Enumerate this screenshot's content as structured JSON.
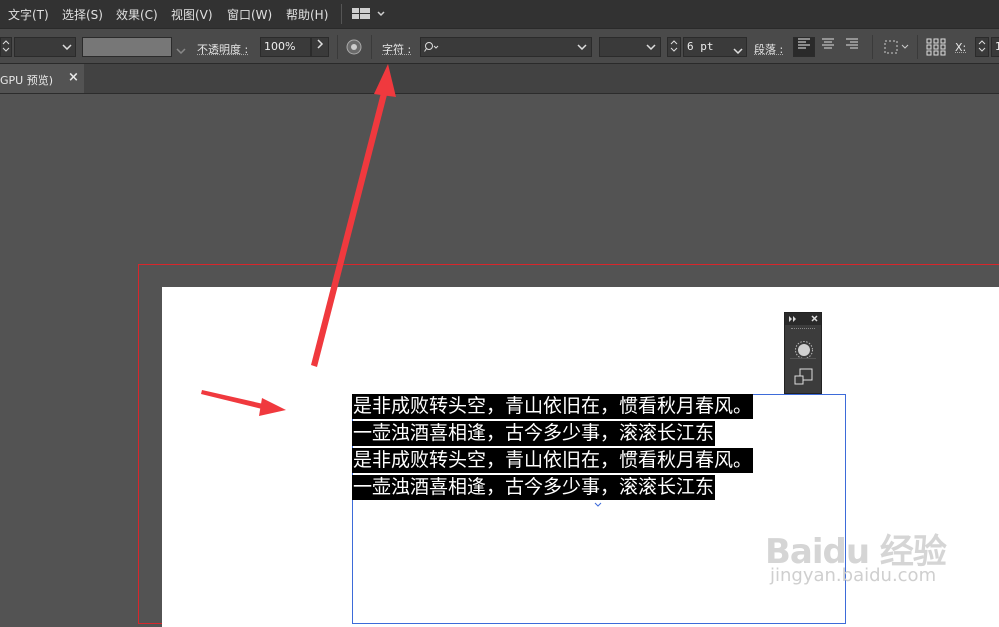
{
  "menu": {
    "items": [
      "文字(T)",
      "选择(S)",
      "效果(C)",
      "视图(V)",
      "窗口(W)",
      "帮助(H)"
    ]
  },
  "control": {
    "opacity_label": "不透明度 :",
    "opacity_value": "100%",
    "char_label": "字符 :",
    "size_value": "6 pt",
    "para_label": "段落 :",
    "x_label": "X:",
    "x_value": "1"
  },
  "tab": {
    "title": "GPU 预览)",
    "close": "×"
  },
  "text_content": {
    "lines": [
      "是非成败转头空，青山依旧在，惯看秋月春风。",
      "一壶浊酒喜相逢，古今多少事，滚滚长江东",
      "是非成败转头空，青山依旧在，惯看秋月春风。",
      "一壶浊酒喜相逢，古今多少事，滚滚长江东"
    ]
  },
  "watermark": {
    "logo": "Baidu 经验",
    "url": "jingyan.baidu.com"
  },
  "colors": {
    "annotation_arrow": "#f0393e",
    "artboard_outline": "#d8262b",
    "text_frame": "#3d6bd9"
  }
}
